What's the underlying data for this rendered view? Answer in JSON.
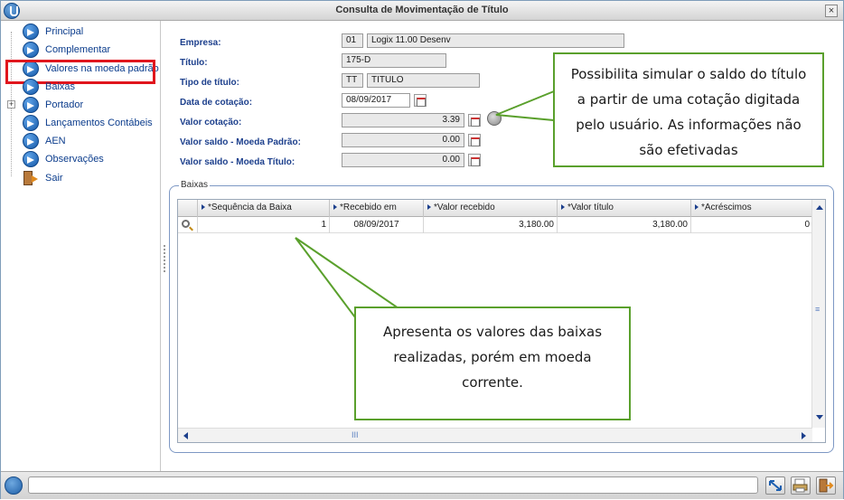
{
  "window": {
    "title": "Consulta de Movimentação de Título",
    "close_label": "×"
  },
  "sidebar": {
    "items": [
      {
        "label": "Principal",
        "icon": "arrow-right-icon"
      },
      {
        "label": "Complementar",
        "icon": "arrow-right-icon"
      },
      {
        "label": "Valores na moeda padrão",
        "icon": "arrow-right-icon"
      },
      {
        "label": "Baixas",
        "icon": "arrow-right-icon"
      },
      {
        "label": "Portador",
        "icon": "arrow-right-icon"
      },
      {
        "label": "Lançamentos Contábeis",
        "icon": "arrow-right-icon"
      },
      {
        "label": "AEN",
        "icon": "arrow-right-icon"
      },
      {
        "label": "Observações",
        "icon": "arrow-right-icon"
      },
      {
        "label": "Sair",
        "icon": "exit-door-icon"
      }
    ],
    "expander_symbol": "+",
    "highlight_color": "#e0161d"
  },
  "form": {
    "empresa": {
      "label": "Empresa:",
      "code": "01",
      "name": "Logix 11.00 Desenv"
    },
    "titulo": {
      "label": "Título:",
      "value": "175-D"
    },
    "tipo_titulo": {
      "label": "Tipo de título:",
      "code": "TT",
      "name": "TITULO"
    },
    "data_cotacao": {
      "label": "Data de cotação:",
      "value": "08/09/2017"
    },
    "valor_cotacao": {
      "label": "Valor cotação:",
      "value": "3.39"
    },
    "saldo_moeda_padrao": {
      "label": "Valor saldo - Moeda Padrão:",
      "value": "0.00"
    },
    "saldo_moeda_titulo": {
      "label": "Valor saldo - Moeda Título:",
      "value": "0.00"
    }
  },
  "baixas": {
    "group_title": "Baixas",
    "columns": [
      "*Sequência da Baixa",
      "*Recebido em",
      "*Valor recebido",
      "*Valor título",
      "*Acréscimos"
    ],
    "rows": [
      {
        "sequencia": "1",
        "recebido_em": "08/09/2017",
        "valor_recebido": "3,180.00",
        "valor_titulo": "3,180.00",
        "acrescimos": "0"
      }
    ],
    "scroll_grip_h": "III",
    "scroll_grip_v": "≡"
  },
  "callouts": {
    "top": "Possibilita simular o saldo do título a partir de uma cotação digitada pelo usuário. As informações não são efetivadas",
    "bottom": "Apresenta os valores das baixas realizadas, porém em moeda corrente.",
    "border_color": "#5aa02c"
  },
  "colors": {
    "label_blue": "#1c3f8c",
    "nav_blue": "#0b3c8c",
    "group_border": "#7d98c4"
  }
}
